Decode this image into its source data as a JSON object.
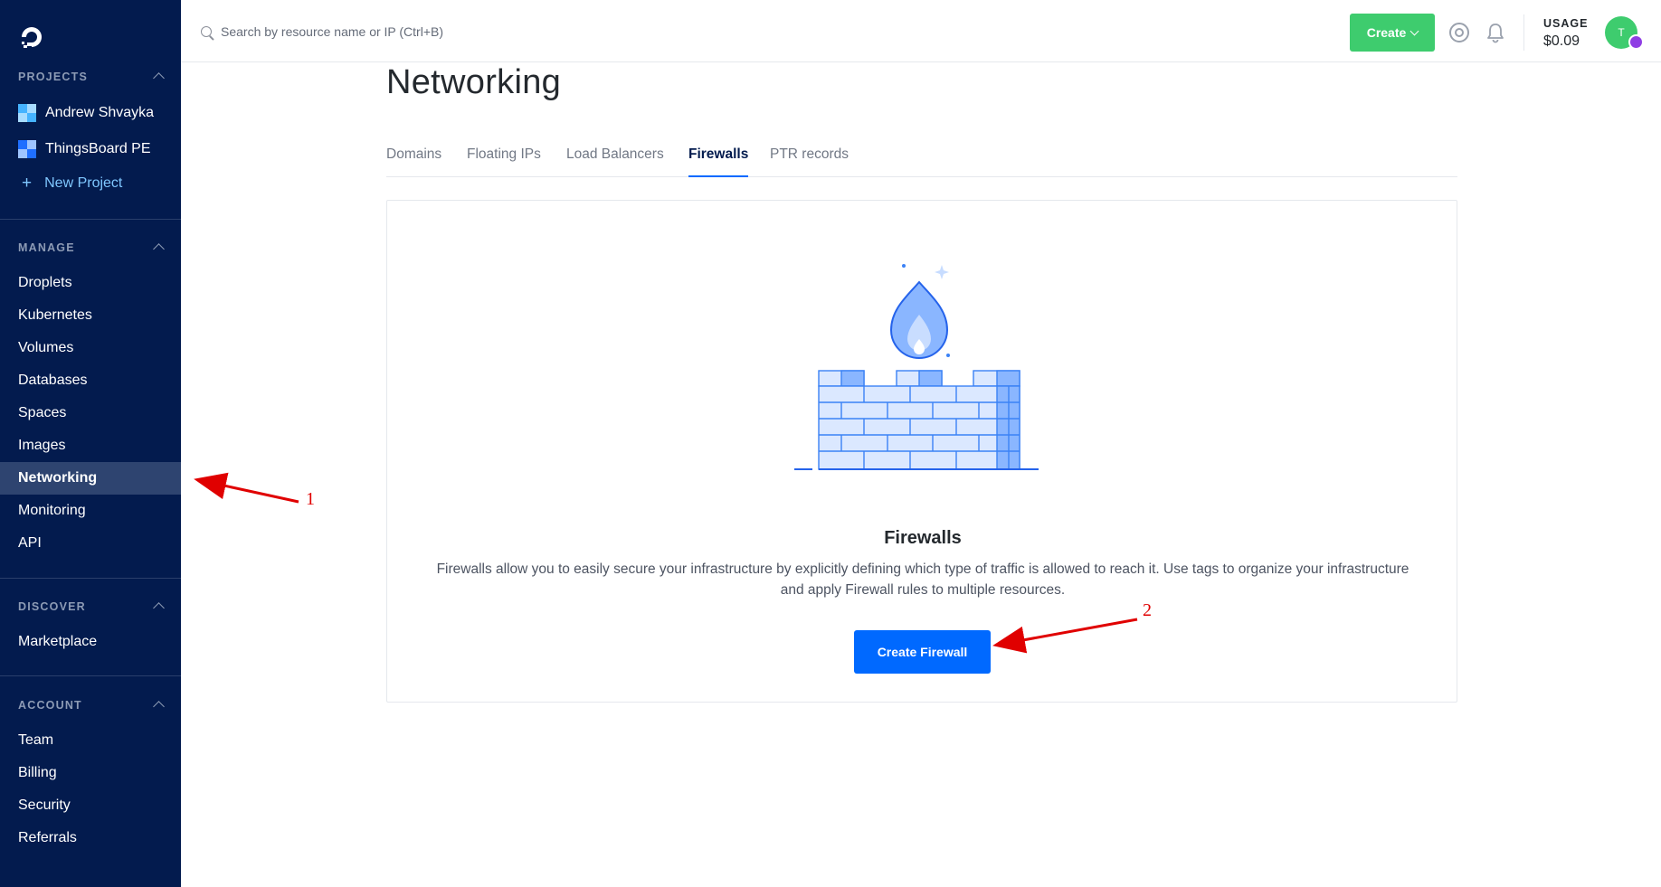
{
  "sidebar": {
    "sections": {
      "projects": "PROJECTS",
      "manage": "MANAGE",
      "discover": "DISCOVER",
      "account": "ACCOUNT"
    },
    "projects": [
      {
        "label": "Andrew Shvayka"
      },
      {
        "label": "ThingsBoard PE"
      }
    ],
    "new_project": "New Project",
    "manage_items": [
      "Droplets",
      "Kubernetes",
      "Volumes",
      "Databases",
      "Spaces",
      "Images",
      "Networking",
      "Monitoring",
      "API"
    ],
    "discover_items": [
      "Marketplace"
    ],
    "account_items": [
      "Team",
      "Billing",
      "Security",
      "Referrals"
    ],
    "active_item": "Networking"
  },
  "topbar": {
    "search_placeholder": "Search by resource name or IP (Ctrl+B)",
    "create_label": "Create",
    "usage_label": "USAGE",
    "usage_value": "$0.09",
    "avatar_initial": "T"
  },
  "main": {
    "title": "Networking",
    "tabs": [
      "Domains",
      "Floating IPs",
      "Load Balancers",
      "Firewalls",
      "PTR records"
    ],
    "active_tab": "Firewalls",
    "empty_state": {
      "title": "Firewalls",
      "description": "Firewalls allow you to easily secure your infrastructure by explicitly defining which type of traffic is allowed to reach it. Use tags to organize your infrastructure and apply Firewall rules to multiple resources.",
      "button": "Create Firewall"
    }
  },
  "annotations": {
    "label_1": "1",
    "label_2": "2",
    "arrow_color": "#e00000"
  },
  "colors": {
    "sidebar_bg": "#031b4e",
    "sidebar_active": "#2e4470",
    "primary": "#0069ff",
    "create_green": "#3ecc6e"
  }
}
